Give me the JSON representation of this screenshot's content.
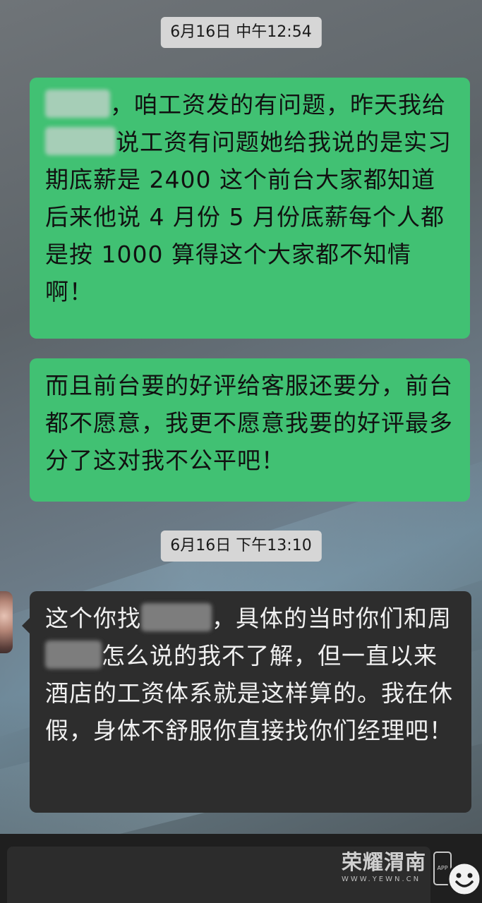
{
  "messages": [
    {
      "type": "timestamp",
      "text": "6月16日 中午12:54"
    },
    {
      "type": "sent",
      "segments": [
        "，咱工资发的有问题，昨天我给",
        "说工资有问题她给我说的是实习期底薪是 2400 这个前台大家都知道后来他说 4 月份 5 月份底薪每个人都是按 1000 算得这个大家都不知情啊！"
      ]
    },
    {
      "type": "sent",
      "text": "而且前台要的好评给客服还要分，前台都不愿意，我更不愿意我要的好评最多分了这对我不公平吧！"
    },
    {
      "type": "timestamp",
      "text": "6月16日 下午13:10"
    },
    {
      "type": "received",
      "segments": [
        "这个你找",
        "，具体的当时你们和周",
        "怎么说的我不了解，但一直以来酒店的工资体系就是这样算的。我在休假，身体不舒服你直接找你们经理吧！"
      ]
    }
  ],
  "watermark": {
    "brand": "荣耀渭南",
    "url": "WWW.YEWN.CN",
    "app_label": "APP"
  },
  "icons": {
    "emoji": "smiley-face-icon"
  }
}
